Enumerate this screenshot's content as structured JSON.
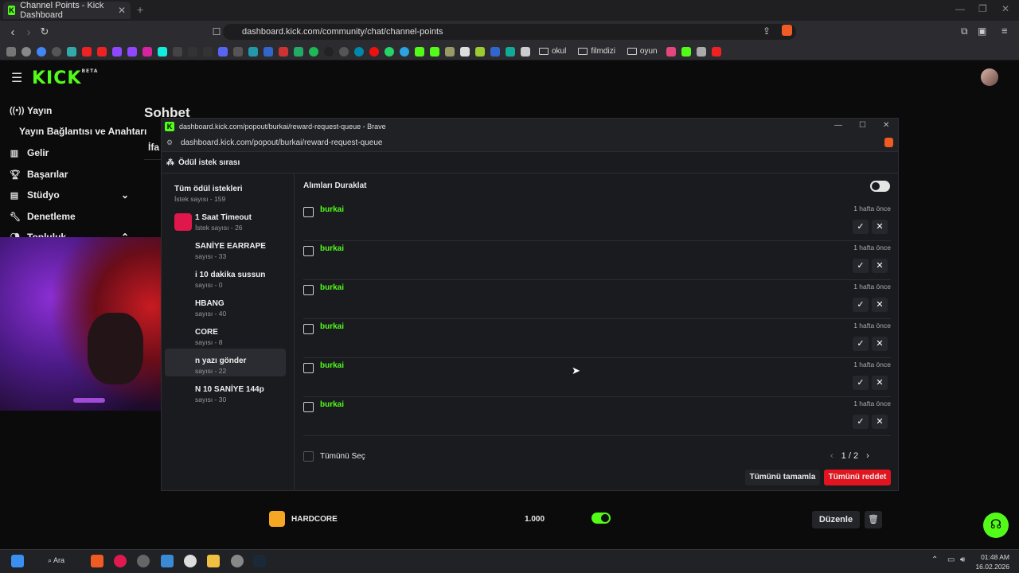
{
  "browser": {
    "tab_title": "Channel Points - Kick Dashboard",
    "url": "dashboard.kick.com/community/chat/channel-points",
    "bookmarks": [
      {
        "label": "okul"
      },
      {
        "label": "filmdizi"
      },
      {
        "label": "oyun"
      }
    ]
  },
  "kick": {
    "logo": "KICK",
    "logo_badge": "BETA",
    "sidebar": [
      {
        "label": "Yayın",
        "icon": "broadcast-icon"
      },
      {
        "label": "Yayın Bağlantısı ve Anahtarı",
        "icon": ""
      },
      {
        "label": "Gelir",
        "icon": "chart-icon"
      },
      {
        "label": "Başarılar",
        "icon": "trophy-icon"
      },
      {
        "label": "Stüdyo",
        "icon": "studio-icon"
      },
      {
        "label": "Denetleme",
        "icon": "wrench-icon"
      },
      {
        "label": "Topluluk",
        "icon": "people-icon"
      }
    ],
    "page_title": "Sohbet",
    "tab_fragment": "İfa",
    "bottom_reward": {
      "name": "HARDCORE",
      "cost": "1.000",
      "edit": "Düzenle"
    }
  },
  "popup": {
    "window_title": "dashboard.kick.com/popout/burkai/reward-request-queue - Brave",
    "url": "dashboard.kick.com/popout/burkai/reward-request-queue",
    "header": "Ödül istek sırası",
    "rewards": [
      {
        "name": "Tüm ödül istekleri",
        "count": "İstek sayısı - 159"
      },
      {
        "name": "1 Saat Timeout",
        "count": "İstek sayısı - 26"
      },
      {
        "name": "SANİYE EARRAPE",
        "count": "sayısı - 33"
      },
      {
        "name": "i 10 dakika sussun",
        "count": "sayısı - 0"
      },
      {
        "name": "HBANG",
        "count": "sayısı - 40"
      },
      {
        "name": "CORE",
        "count": "sayısı - 8"
      },
      {
        "name": "n yazı gönder",
        "count": "sayısı - 22"
      },
      {
        "name": "N 10 SANİYE 144p",
        "count": "sayısı - 30"
      }
    ],
    "pause_label": "Alımları Duraklat",
    "requests": [
      {
        "user": "burkai",
        "time": "1 hafta önce"
      },
      {
        "user": "burkai",
        "time": "1 hafta önce"
      },
      {
        "user": "burkai",
        "time": "1 hafta önce"
      },
      {
        "user": "burkai",
        "time": "1 hafta önce"
      },
      {
        "user": "burkai",
        "time": "1 hafta önce"
      },
      {
        "user": "burkai",
        "time": "1 hafta önce"
      }
    ],
    "select_all": "Tümünü Seç",
    "page": "1 / 2",
    "complete_all": "Tümünü tamamla",
    "reject_all": "Tümünü reddet"
  },
  "taskbar": {
    "search": "Ara",
    "time": "01:48 AM",
    "date": "16.02.2026"
  }
}
